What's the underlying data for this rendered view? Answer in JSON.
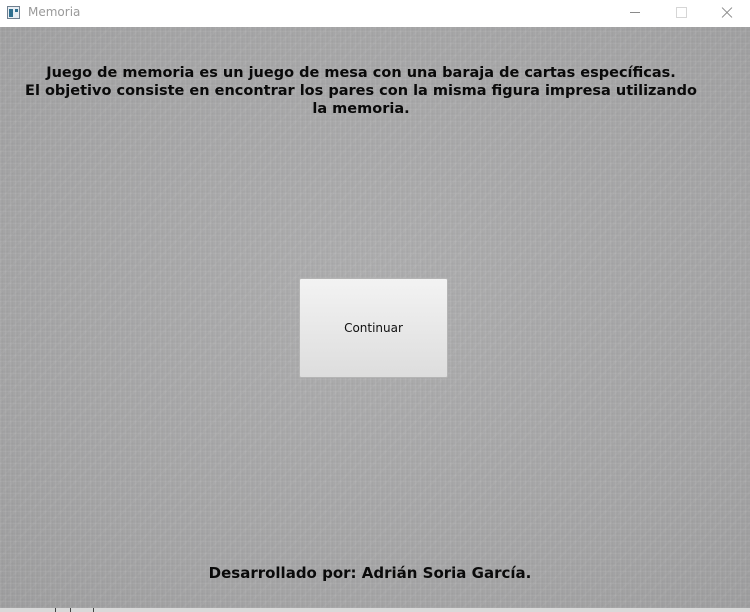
{
  "window": {
    "title": "Memoria",
    "icon": "java-app-icon"
  },
  "main": {
    "description_lines": [
      "Juego de memoria es un juego de mesa con una baraja de cartas específicas.",
      "El objetivo consiste en encontrar los pares con la misma figura impresa utilizando",
      "la memoria."
    ],
    "continue_label": "Continuar",
    "credits": "Desarrollado por: Adrián Soria García."
  },
  "colors": {
    "background": "#a7a7a8",
    "button_top": "#f3f3f3",
    "button_bottom": "#dddddd",
    "text": "#0a0a0a"
  }
}
